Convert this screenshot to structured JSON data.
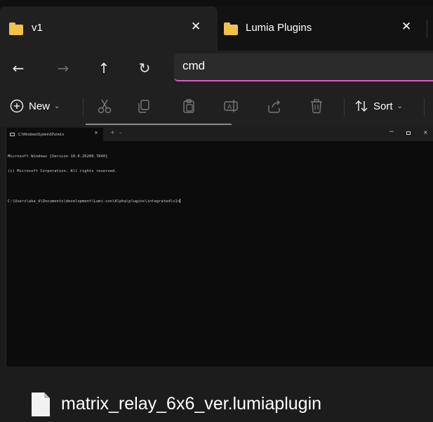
{
  "tabs": [
    {
      "label": "v1",
      "close": "✕",
      "icon": "folder-icon",
      "active": true
    },
    {
      "label": "Lumia Plugins",
      "close": "✕",
      "icon": "folder-icon",
      "active": false
    }
  ],
  "nav": {
    "back": "←",
    "forward": "→",
    "up": "↑",
    "refresh": "↻",
    "address_value": "cmd"
  },
  "commandbar": {
    "new_label": "New",
    "new_chevron": "⌄",
    "sort_label": "Sort",
    "sort_chevron": "⌄",
    "buttons": [
      "cut-icon",
      "copy-icon",
      "paste-icon",
      "rename-icon",
      "share-icon",
      "delete-icon"
    ]
  },
  "console": {
    "tab_title": "C:\\Windows\\System32\\cmd.e",
    "tab_close": "×",
    "new_tab": "+",
    "dropdown": "⌄",
    "minimize": "−",
    "close": "×",
    "lines": [
      "Microsoft Windows [Version 10.0.26200.7840]",
      "(c) Microsoft Corporation. All rights reserved.",
      "",
      "C:\\Users\\aka_d\\Documents\\development\\Lumi-con\\Alpha\\plugins\\integrated\\v1>"
    ]
  },
  "drag_file": {
    "name": "matrix_relay_6x6_ver.lumiaplugin"
  },
  "colors": {
    "folder": "#f2c14a",
    "accent": "#e05ac2",
    "console_bg": "#0c0c0c",
    "chrome_bg": "#202020"
  }
}
